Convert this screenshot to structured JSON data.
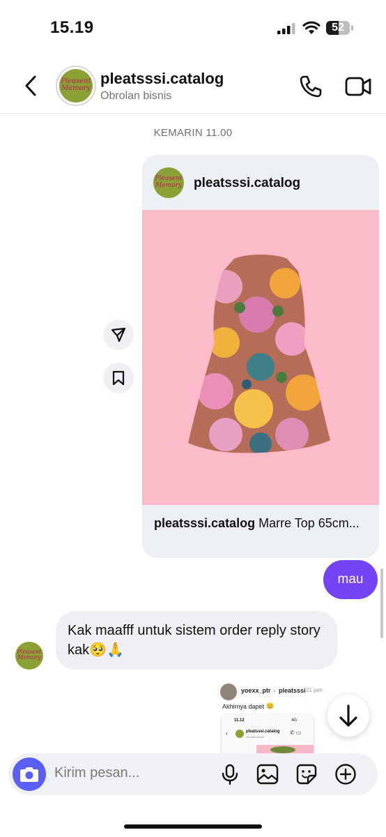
{
  "status_bar": {
    "time": "15.19",
    "battery": "52",
    "battery_level": 0.52
  },
  "header": {
    "username": "pleatsssi.catalog",
    "subtitle": "Obrolan bisnis",
    "logo_text": "Pleasent Memory"
  },
  "chat": {
    "timestamp": "KEMARIN 11.00",
    "shared_post": {
      "username": "pleatsssi.catalog",
      "caption_user": "pleatsssi.catalog",
      "caption_text": " Marre Top 65cm..."
    },
    "messages": [
      {
        "from": "me",
        "text": "mau"
      },
      {
        "from": "them",
        "text": "Kak maafff untuk sistem order reply story kak🥺🙏"
      }
    ],
    "story_reply": {
      "from_user": "yoexx_ptr",
      "arrow": "›",
      "to_user": "pleatsssi",
      "time": "21 jam",
      "text": "Akhirnya dapet",
      "emoji": "😊",
      "mini_time": "11.12",
      "mini_status": "4G",
      "mini_name": "pleatsssi.catalog",
      "mini_sub": "Obrolan bisnis"
    }
  },
  "composer": {
    "placeholder": "Kirim pesan..."
  },
  "colors": {
    "accent": "#7443f5",
    "camera": "#5b5ff5",
    "logo_bg": "#8ba135",
    "post_bg": "#fbbbc8"
  },
  "icons": [
    "back-arrow-icon",
    "phone-icon",
    "video-camera-icon",
    "send-icon",
    "bookmark-icon",
    "arrow-down-icon",
    "camera-icon",
    "microphone-icon",
    "image-icon",
    "sticker-icon",
    "plus-circle-icon"
  ]
}
